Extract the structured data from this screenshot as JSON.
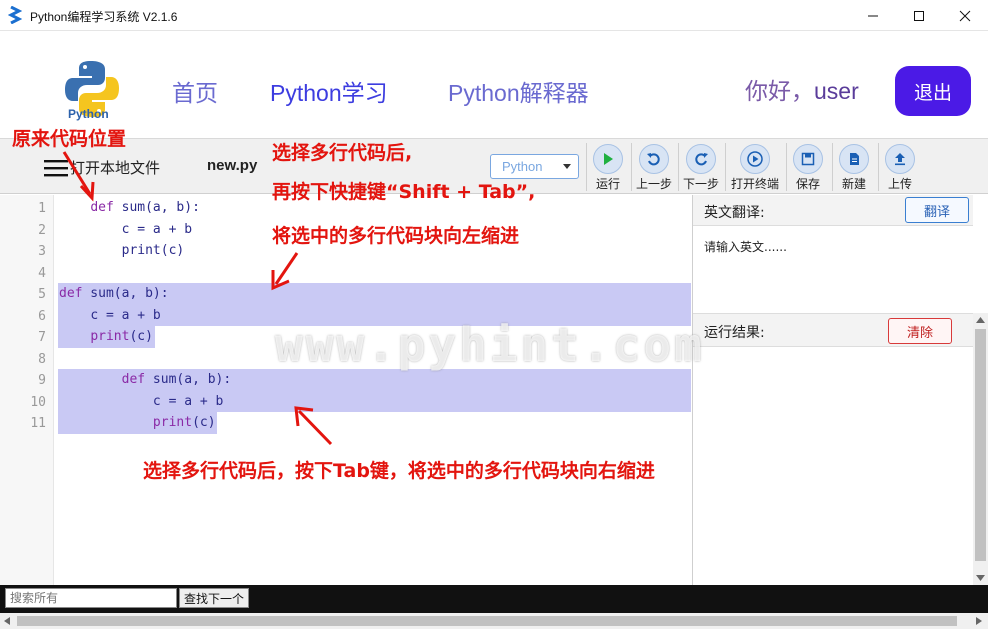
{
  "window": {
    "title": "Python编程学习系统 V2.1.6"
  },
  "header": {
    "logo_text": "Python",
    "nav": {
      "home": "首页",
      "learn": "Python学习",
      "interpreter": "Python解释器"
    },
    "greeting": "你好，",
    "username": "user",
    "logout_label": "退出",
    "accent_color": "#4b1ae6"
  },
  "toolbar": {
    "open_local_file": "打开本地文件",
    "filename": "new.py",
    "language": "Python",
    "buttons": [
      {
        "label": "运行",
        "icon": "play-icon"
      },
      {
        "label": "上一步",
        "icon": "undo-icon"
      },
      {
        "label": "下一步",
        "icon": "redo-icon"
      },
      {
        "label": "打开终端",
        "icon": "terminal-icon"
      },
      {
        "label": "保存",
        "icon": "save-icon"
      },
      {
        "label": "新建",
        "icon": "new-file-icon"
      },
      {
        "label": "上传",
        "icon": "upload-icon"
      }
    ]
  },
  "editor": {
    "line_numbers": [
      "1",
      "2",
      "3",
      "4",
      "5",
      "6",
      "7",
      "8",
      "9",
      "10",
      "11"
    ],
    "lines": [
      {
        "indent": "    ",
        "kw": "def",
        "rest": " sum(a, b):"
      },
      {
        "indent": "        ",
        "kw": "",
        "rest": "c = a + b"
      },
      {
        "indent": "        ",
        "kw": "",
        "rest": "print(c)"
      },
      {
        "indent": "",
        "kw": "",
        "rest": ""
      },
      {
        "indent": "",
        "kw": "def",
        "rest": " sum(a, b):"
      },
      {
        "indent": "    ",
        "kw": "",
        "rest": "c = a + b"
      },
      {
        "indent": "    ",
        "kw": "print",
        "rest": "(c)"
      },
      {
        "indent": "",
        "kw": "",
        "rest": ""
      },
      {
        "indent": "        ",
        "kw": "def",
        "rest": " sum(a, b):"
      },
      {
        "indent": "            ",
        "kw": "",
        "rest": "c = a + b"
      },
      {
        "indent": "            ",
        "kw": "print",
        "rest": "(c)"
      }
    ]
  },
  "translate_panel": {
    "label": "英文翻译:",
    "button": "翻译",
    "placeholder": "请输入英文......"
  },
  "result_panel": {
    "label": "运行结果:",
    "button": "清除"
  },
  "search": {
    "placeholder": "搜索所有",
    "find_next": "查找下一个"
  },
  "annotations": {
    "original_position": "原来代码位置",
    "shift_tab_1": "选择多行代码后,",
    "shift_tab_2": "再按下快捷键“Shift + Tab”,",
    "shift_tab_3": "将选中的多行代码块向左缩进",
    "tab": "选择多行代码后，按下Tab键，将选中的多行代码块向右缩进",
    "watermark": "www.pyhint.com"
  }
}
